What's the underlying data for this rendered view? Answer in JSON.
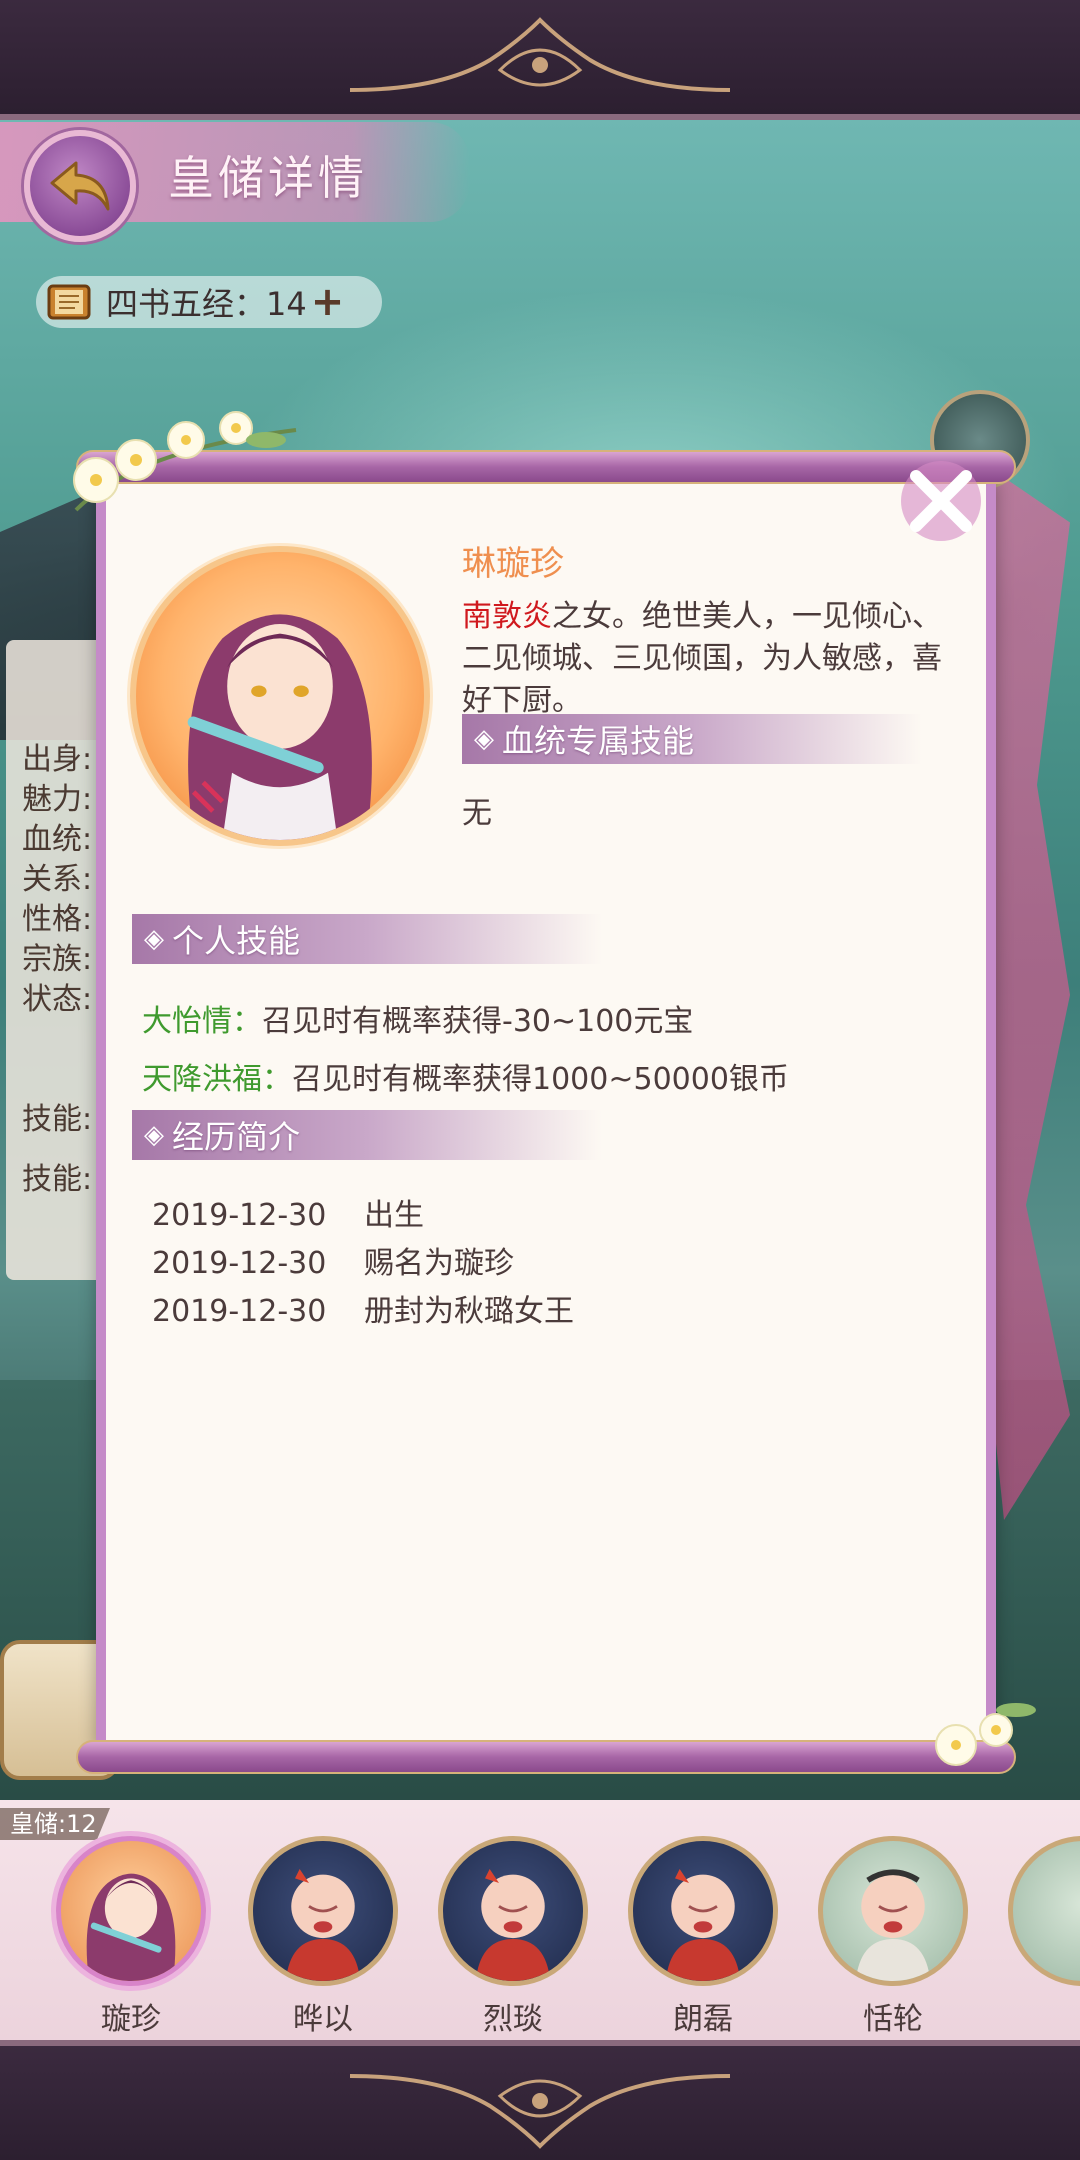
{
  "header": {
    "title": "皇储详情",
    "resource": {
      "text": "四书五经：14",
      "icon": "book-icon"
    }
  },
  "modal": {
    "name": "琳璇珍",
    "bio": {
      "father": "南敦炎",
      "text": "之女。绝世美人，一见倾心、二见倾城、三见倾国，为人敏感，喜好下厨。"
    },
    "bloodline_section": "血统专属技能",
    "bloodline_value": "无",
    "skills_section": "个人技能",
    "skills": [
      {
        "name": "大怡情：",
        "desc": "召见时有概率获得-30~100元宝"
      },
      {
        "name": "天降洪福：",
        "desc": "召见时有概率获得1000~50000银币"
      }
    ],
    "history_section": "经历简介",
    "history": [
      {
        "date": "2019-12-30",
        "event": "出生"
      },
      {
        "date": "2019-12-30",
        "event": "赐名为璇珍"
      },
      {
        "date": "2019-12-30",
        "event": "册封为秋璐女王"
      }
    ]
  },
  "left_panel": {
    "rows": [
      "出身:",
      "魅力:",
      "血统:",
      "关系:",
      "性格:",
      "宗族:",
      "状态:",
      "技能:",
      "技能:"
    ]
  },
  "heirs": {
    "count_label": "皇储:12",
    "items": [
      {
        "name": "璇珍",
        "selected": true
      },
      {
        "name": "晔以"
      },
      {
        "name": "烈琰"
      },
      {
        "name": "朗磊"
      },
      {
        "name": "恬轮"
      }
    ]
  },
  "colors": {
    "accent": "#c58bc8",
    "name": "#ef8f4f",
    "father": "#d0191e",
    "skill": "#3f9a2e"
  }
}
